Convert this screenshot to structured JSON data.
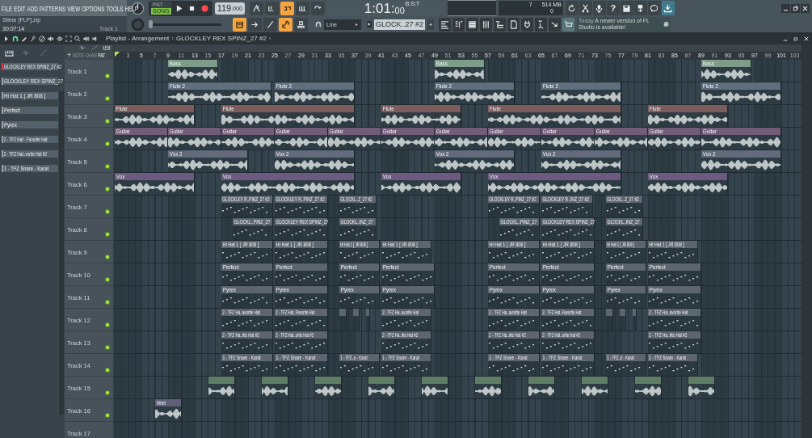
{
  "menu": [
    "FILE",
    "EDIT",
    "ADD",
    "PATTERNS",
    "VIEW",
    "OPTIONS",
    "TOOLS",
    "HELP"
  ],
  "mode": [
    {
      "label": "PAT",
      "selected": false
    },
    {
      "label": "SONG",
      "selected": true
    }
  ],
  "recording": true,
  "tempo": {
    "value": "119",
    "fraction": ".000"
  },
  "transport_tools": [
    {
      "kind": "metronome",
      "on": false
    },
    {
      "kind": "wait",
      "on": false
    },
    {
      "kind": "countdown",
      "on": true
    },
    {
      "kind": "step",
      "on": false
    },
    {
      "kind": "blend",
      "on": false
    }
  ],
  "time": {
    "value": "1:01:",
    "sub": "00",
    "unit": "B:S:T"
  },
  "cpu": {
    "voices": "7",
    "memory": "514 MB",
    "polyphony": "0"
  },
  "help_label": "?",
  "info": {
    "file": "Slime [FLP].zip",
    "elapsed": "30:07:14",
    "target": "Track 1"
  },
  "master_volume": {
    "level": 0
  },
  "snap_tools": [
    {
      "kind": "piano",
      "on": true
    },
    {
      "kind": "arrow",
      "on": false
    },
    {
      "kind": "curve",
      "on": false
    },
    {
      "kind": "link",
      "on": true
    },
    {
      "kind": "stamp",
      "on": false
    }
  ],
  "snap": "Line",
  "pattern": "GLOCK..27 #2",
  "pattern_add": "+",
  "news": {
    "date": "Today",
    "text": "A newer version of FL Studio is available!"
  },
  "playlist": {
    "title": "Playlist - Arrangement",
    "separator": "›",
    "pattern": "GLOCKLEY REX SPINZ_27 #2",
    "end": "›"
  },
  "picker_tabs": [
    {
      "label": "NOTE",
      "selected": false
    },
    {
      "label": "CHAN",
      "selected": false
    },
    {
      "label": "PAT",
      "selected": true
    }
  ],
  "add_track": "+",
  "picker": [
    {
      "name": "GLOCKLEY REX SPINZ_27 #2",
      "selected": true
    },
    {
      "name": "GLOCKLEY REX SPINZ_27",
      "selected": false
    },
    {
      "name": "Hi Hat 1 [ JR 808 ]",
      "selected": false
    },
    {
      "name": "Perfect",
      "selected": false
    },
    {
      "name": "Pyrex",
      "selected": false
    },
    {
      "name": "2 - TFZ Hat - Favorite Hat",
      "selected": false
    },
    {
      "name": "2 - TFZ Hat..vorite Hat #2",
      "selected": false
    },
    {
      "name": "1 - TFZ Snare - Karat",
      "selected": false
    }
  ],
  "ruler": [
    "3",
    "5",
    "7",
    "9",
    "11",
    "13",
    "15",
    "17",
    "19",
    "21",
    "23",
    "25",
    "27",
    "29",
    "31",
    "33",
    "35",
    "37",
    "39",
    "41",
    "43",
    "45",
    "47",
    "49",
    "51",
    "53",
    "55",
    "57",
    "59",
    "61",
    "63",
    "65",
    "67",
    "69",
    "71",
    "73",
    "75",
    "77",
    "79",
    "81",
    "83",
    "85",
    "87",
    "89",
    "91",
    "93",
    "95",
    "97",
    "99",
    "101",
    "103"
  ],
  "tracks": [
    {
      "name": "Track 1",
      "enabled": true,
      "color": "#7e9c8a",
      "clips": [
        {
          "kind": "audio",
          "name": "Bass"
        },
        {
          "kind": "audio",
          "name": "Bass"
        },
        {
          "kind": "audio",
          "name": "Bass"
        }
      ]
    },
    {
      "name": "Track 2",
      "enabled": true,
      "color": "#5f6f7e",
      "clips": [
        {
          "kind": "audio",
          "name": "Flute 2"
        },
        {
          "kind": "audio",
          "name": "Flute 2"
        },
        {
          "kind": "audio",
          "name": "Flute 2"
        },
        {
          "kind": "audio",
          "name": "Flute 2"
        },
        {
          "kind": "audio",
          "name": "Flute 2"
        }
      ]
    },
    {
      "name": "Track 3",
      "enabled": true,
      "color": "#7d5c5c",
      "clips": [
        {
          "kind": "audio",
          "name": "Flute"
        },
        {
          "kind": "audio",
          "name": "Flute"
        },
        {
          "kind": "audio",
          "name": "Flute"
        },
        {
          "kind": "audio",
          "name": "Flute"
        },
        {
          "kind": "audio",
          "name": "Flute"
        }
      ]
    },
    {
      "name": "Track 4",
      "enabled": true,
      "color": "#735c78",
      "clips": [
        {
          "kind": "audio",
          "name": "Guitar"
        },
        {
          "kind": "audio",
          "name": "Guitar"
        },
        {
          "kind": "audio",
          "name": "Guitar"
        },
        {
          "kind": "audio",
          "name": "Guitar"
        },
        {
          "kind": "audio",
          "name": "Guitar"
        },
        {
          "kind": "audio",
          "name": "Guitar"
        },
        {
          "kind": "audio",
          "name": "Guitar"
        },
        {
          "kind": "audio",
          "name": "Guitar"
        },
        {
          "kind": "audio",
          "name": "Guitar"
        },
        {
          "kind": "audio",
          "name": "Guitar"
        },
        {
          "kind": "audio",
          "name": "Guitar"
        },
        {
          "kind": "audio",
          "name": "Guitar"
        }
      ]
    },
    {
      "name": "Track 5",
      "enabled": true,
      "color": "#626a7c",
      "clips": [
        {
          "kind": "audio",
          "name": "Vox 2"
        },
        {
          "kind": "audio",
          "name": "Vox 2"
        },
        {
          "kind": "audio",
          "name": "Vox 2"
        },
        {
          "kind": "audio",
          "name": "Vox 2"
        },
        {
          "kind": "audio",
          "name": "Vox 2"
        }
      ]
    },
    {
      "name": "Track 6",
      "enabled": true,
      "color": "#6e5a80",
      "clips": [
        {
          "kind": "audio",
          "name": "Vox"
        },
        {
          "kind": "audio",
          "name": "Vox"
        },
        {
          "kind": "audio",
          "name": "Vox"
        },
        {
          "kind": "audio",
          "name": "Vox"
        },
        {
          "kind": "audio",
          "name": "Vox"
        }
      ]
    },
    {
      "name": "Track 7",
      "enabled": true,
      "color": "#5d666e",
      "clips": [
        {
          "kind": "pattern",
          "name": "GLOCKLEY R..PINZ_27 #2"
        },
        {
          "kind": "pattern",
          "name": "GLOCKLEY R..PINZ_27 #2"
        },
        {
          "kind": "pattern",
          "name": "GLOCKL..Z_27 #2"
        },
        {
          "kind": "pattern",
          "name": "GLOCKLEY R..PINZ_27 #2"
        },
        {
          "kind": "pattern",
          "name": "GLOCKLEY R..INZ_27 #2"
        },
        {
          "kind": "pattern",
          "name": "GLOCKL..Z_27 #2"
        }
      ]
    },
    {
      "name": "Track 8",
      "enabled": true,
      "color": "#5d666e",
      "clips": [
        {
          "kind": "pattern",
          "name": "GLOCKL..PINZ_27"
        },
        {
          "kind": "pattern",
          "name": "GLOCKLEY REX SPINZ_27"
        },
        {
          "kind": "pattern",
          "name": "GLOCKL..INZ_27"
        },
        {
          "kind": "pattern",
          "name": "GLOCKL..PINZ_27"
        },
        {
          "kind": "pattern",
          "name": "GLOCKLEY REX SPINZ_27"
        },
        {
          "kind": "pattern",
          "name": "GLOCKL..INZ_27"
        }
      ]
    },
    {
      "name": "Track 9",
      "enabled": true,
      "color": "#5d666e",
      "clips": [
        {
          "kind": "pattern",
          "name": "Hi Hat 1 [ JR 808 ]"
        },
        {
          "kind": "pattern",
          "name": "Hi Hat 1 [ JR 808 ]"
        },
        {
          "kind": "pattern",
          "name": "Hi Hat 1 [ JR 808 ]"
        },
        {
          "kind": "pattern",
          "name": "Hi Hat 1 [ JR 808 ]"
        },
        {
          "kind": "pattern",
          "name": "Hi Hat 1 [ JR 808 ]"
        },
        {
          "kind": "pattern",
          "name": "Hi Hat 1 [ JR 808 ]"
        },
        {
          "kind": "pattern",
          "name": "Hi Hat 1 [ JR 808 ]"
        },
        {
          "kind": "pattern",
          "name": "Hi Hat 1 [ JR 808 ]"
        }
      ]
    },
    {
      "name": "Track 10",
      "enabled": true,
      "color": "#5d666e",
      "clips": [
        {
          "kind": "pattern",
          "name": "Perfect"
        },
        {
          "kind": "pattern",
          "name": "Perfect"
        },
        {
          "kind": "pattern",
          "name": "Perfect"
        },
        {
          "kind": "pattern",
          "name": "Perfect"
        },
        {
          "kind": "pattern",
          "name": "Perfect"
        },
        {
          "kind": "pattern",
          "name": "Perfect"
        },
        {
          "kind": "pattern",
          "name": "Perfect"
        },
        {
          "kind": "pattern",
          "name": "Perfect"
        }
      ]
    },
    {
      "name": "Track 11",
      "enabled": true,
      "color": "#5d666e",
      "clips": [
        {
          "kind": "pattern",
          "name": "Pyrex"
        },
        {
          "kind": "pattern",
          "name": "Pyrex"
        },
        {
          "kind": "pattern",
          "name": "Pyrex"
        },
        {
          "kind": "pattern",
          "name": "Pyrex"
        },
        {
          "kind": "pattern",
          "name": "Pyrex"
        },
        {
          "kind": "pattern",
          "name": "Pyrex"
        },
        {
          "kind": "pattern",
          "name": "Pyrex"
        },
        {
          "kind": "pattern",
          "name": "Pyrex"
        }
      ]
    },
    {
      "name": "Track 12",
      "enabled": true,
      "color": "#5d666e",
      "clips": [
        {
          "kind": "pattern",
          "name": "2 - TFZ Ha..avorite Hat"
        },
        {
          "kind": "pattern",
          "name": "2 - TFZ Hat..Favorite Hat"
        },
        {
          "kind": "pattern"
        },
        {
          "kind": "pattern"
        },
        {
          "kind": "pattern"
        },
        {
          "kind": "pattern",
          "name": "2 - TFZ Ha..avorite Hat"
        },
        {
          "kind": "pattern",
          "name": "2 - TFZ Ha..avorite Hat"
        },
        {
          "kind": "pattern",
          "name": "2 - TFZ Hat..Favorite Hat"
        },
        {
          "kind": "pattern"
        },
        {
          "kind": "pattern"
        },
        {
          "kind": "pattern"
        },
        {
          "kind": "pattern",
          "name": "2 - TFZ Ha..avorite Hat"
        }
      ]
    },
    {
      "name": "Track 13",
      "enabled": true,
      "color": "#5d666e",
      "clips": [
        {
          "kind": "pattern",
          "name": "2 - TFZ Ha..rite Hat #2"
        },
        {
          "kind": "pattern",
          "name": "2 - TFZ Hat..orite Hat #2"
        },
        {
          "kind": "pattern",
          "name": "2 - TFZ Ha..rite Hat #2"
        },
        {
          "kind": "pattern",
          "name": "2 - TFZ Ha..rite Hat #2"
        },
        {
          "kind": "pattern",
          "name": "2 - TFZ Hat..orite Hat #2"
        },
        {
          "kind": "pattern",
          "name": "2 - TFZ Ha..rite Hat #2"
        }
      ]
    },
    {
      "name": "Track 14",
      "enabled": true,
      "color": "#5d666e",
      "clips": [
        {
          "kind": "pattern",
          "name": "1 - TFZ Snare - Karat"
        },
        {
          "kind": "pattern",
          "name": "1 - TFZ Snare - Karat"
        },
        {
          "kind": "pattern",
          "name": "1 - TFZ..e - Karat"
        },
        {
          "kind": "pattern",
          "name": "1 - TFZ Snare - Karat"
        },
        {
          "kind": "pattern",
          "name": "1 - TFZ Snare - Karat"
        },
        {
          "kind": "pattern",
          "name": "1 - TFZ Snare - Karat"
        },
        {
          "kind": "pattern",
          "name": "1 - TFZ..e - Karat"
        },
        {
          "kind": "pattern",
          "name": "1 - TFZ Snare - Karat"
        }
      ]
    },
    {
      "name": "Track 15",
      "enabled": true,
      "color": "#5f7d64",
      "clips": [
        {
          "kind": "audio"
        },
        {
          "kind": "audio"
        },
        {
          "kind": "audio"
        },
        {
          "kind": "audio"
        },
        {
          "kind": "audio"
        },
        {
          "kind": "audio"
        },
        {
          "kind": "audio"
        },
        {
          "kind": "audio"
        },
        {
          "kind": "audio"
        },
        {
          "kind": "audio"
        }
      ]
    },
    {
      "name": "Track 16",
      "enabled": true,
      "color": "#5f5f78",
      "clips": [
        {
          "kind": "audio",
          "name": "Wet"
        }
      ]
    },
    {
      "name": "Track 17"
    }
  ]
}
